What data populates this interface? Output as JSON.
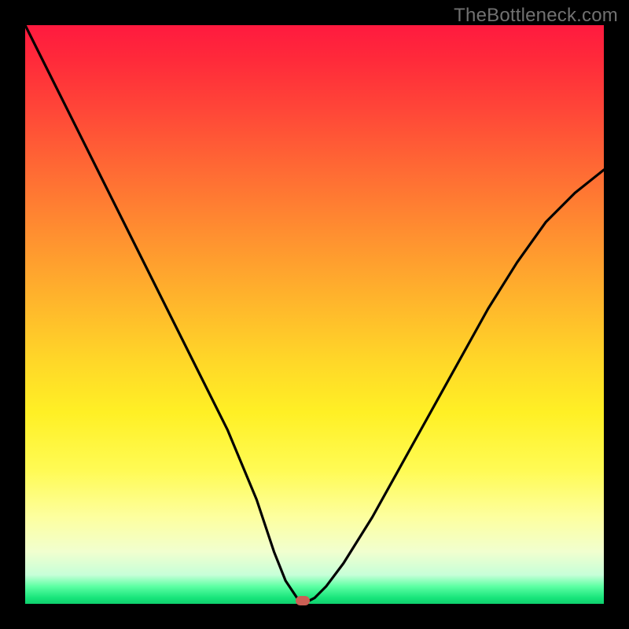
{
  "watermark": "TheBottleneck.com",
  "colors": {
    "frame": "#000000",
    "curve": "#000000",
    "marker": "#cb5f55",
    "gradient_top": "#ff1a3f",
    "gradient_bottom": "#0fcf6d"
  },
  "chart_data": {
    "type": "line",
    "title": "",
    "xlabel": "",
    "ylabel": "",
    "xlim": [
      0,
      100
    ],
    "ylim": [
      0,
      100
    ],
    "grid": false,
    "legend": false,
    "note": "No numeric axis ticks or labels are rendered in the image; x/y are normalized 0–100. The curve is a V-shape with its minimum near x≈48 at the bottom (y≈0). A small rounded marker sits at the minimum.",
    "series": [
      {
        "name": "bottleneck-curve",
        "x": [
          0,
          5,
          10,
          15,
          20,
          25,
          30,
          35,
          40,
          43,
          45,
          47,
          48,
          49,
          50,
          52,
          55,
          60,
          65,
          70,
          75,
          80,
          85,
          90,
          95,
          100
        ],
        "values": [
          100,
          90,
          80,
          70,
          60,
          50,
          40,
          30,
          18,
          9,
          4,
          1,
          0,
          0.5,
          1,
          3,
          7,
          15,
          24,
          33,
          42,
          51,
          59,
          66,
          71,
          75
        ]
      }
    ],
    "marker": {
      "x": 48,
      "y": 0
    }
  }
}
